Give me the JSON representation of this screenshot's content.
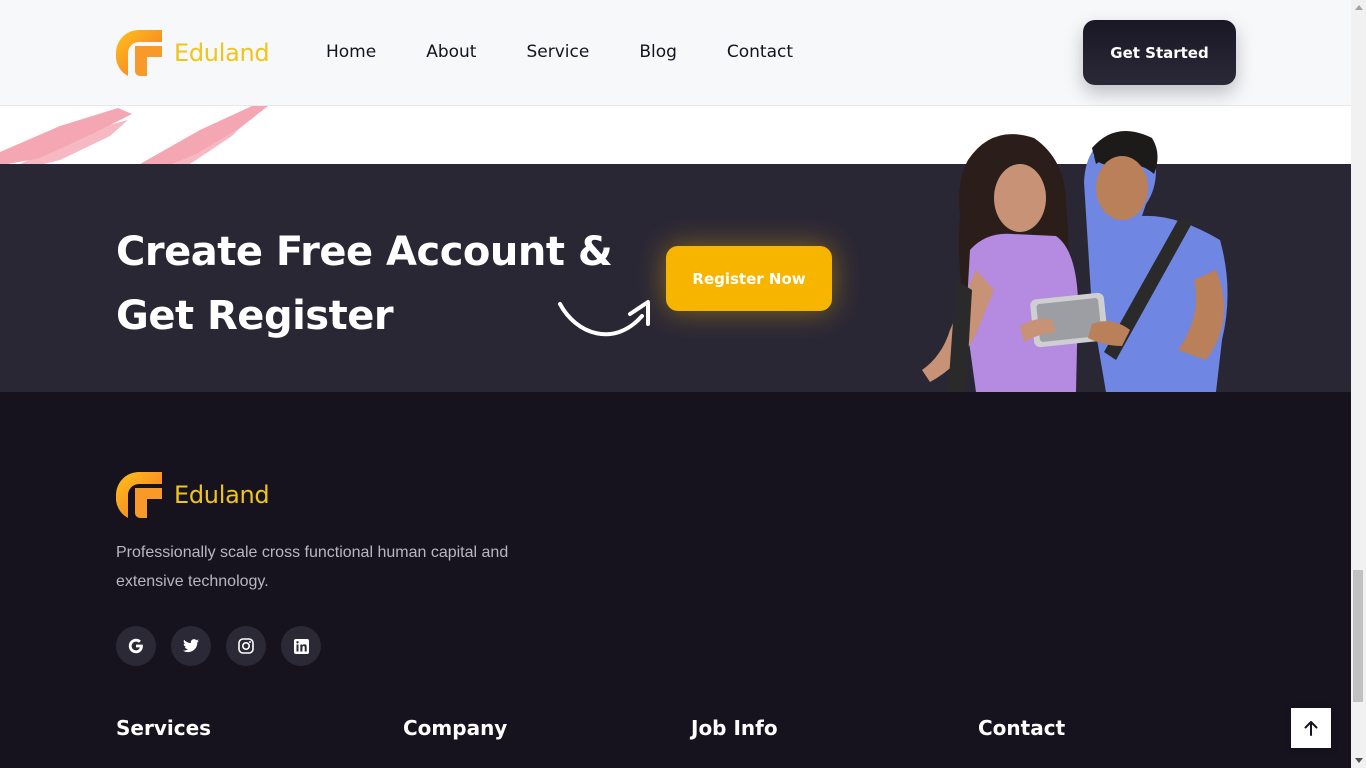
{
  "brand": {
    "name": "Eduland",
    "color": "#f0c419"
  },
  "nav": {
    "items": [
      {
        "label": "Home"
      },
      {
        "label": "About"
      },
      {
        "label": "Service"
      },
      {
        "label": "Blog"
      },
      {
        "label": "Contact"
      }
    ],
    "cta_label": "Get Started"
  },
  "cta": {
    "heading_line1": "Create Free Account &",
    "heading_line2": "Get Register",
    "button_label": "Register Now",
    "accent": "#f8b500"
  },
  "footer": {
    "description": "Professionally scale cross functional human capital and extensive technology.",
    "socials": [
      {
        "icon": "google-icon"
      },
      {
        "icon": "twitter-icon"
      },
      {
        "icon": "instagram-icon"
      },
      {
        "icon": "linkedin-icon"
      }
    ],
    "columns": [
      {
        "title": "Services"
      },
      {
        "title": "Company"
      },
      {
        "title": "Job Info"
      },
      {
        "title": "Contact"
      }
    ]
  },
  "scroll_top_icon": "arrow-up-icon"
}
